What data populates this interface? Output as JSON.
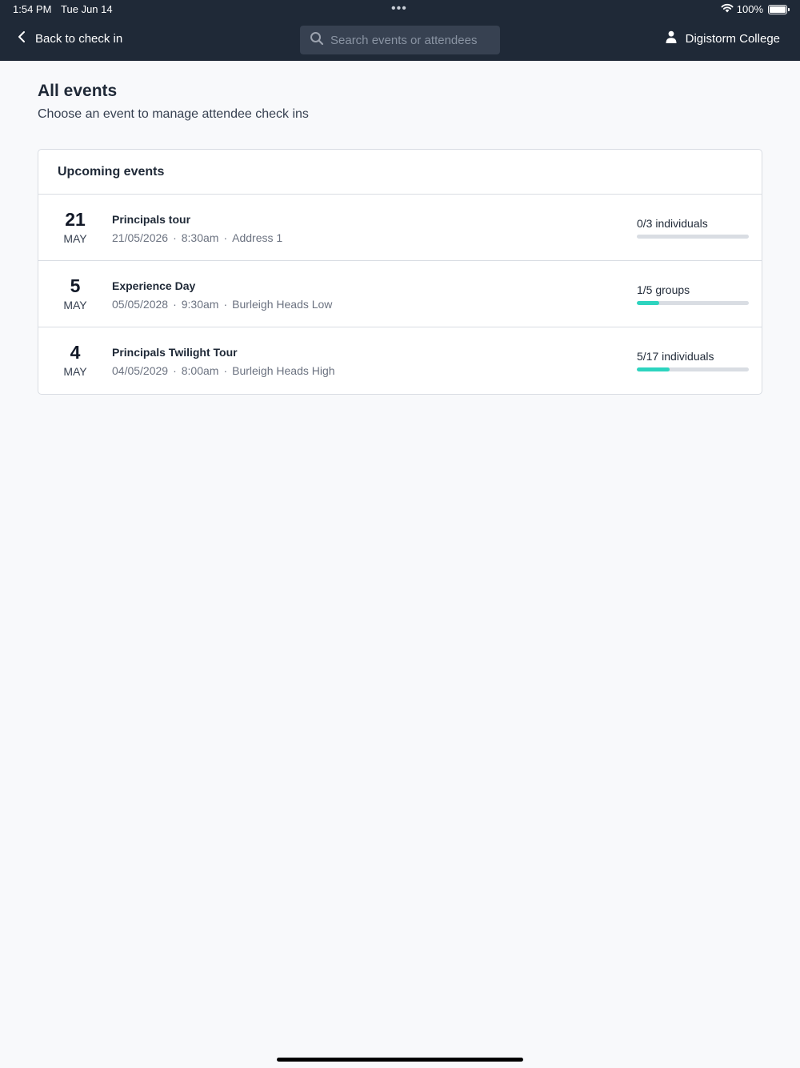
{
  "status_bar": {
    "time": "1:54 PM",
    "date": "Tue Jun 14",
    "battery": "100%",
    "battery_level": 1.0
  },
  "header": {
    "back_label": "Back to check in",
    "search_placeholder": "Search events or attendees",
    "account_name": "Digistorm College"
  },
  "page": {
    "title": "All events",
    "subtitle": "Choose an event to manage attendee check ins"
  },
  "upcoming": {
    "heading": "Upcoming events",
    "events": [
      {
        "day": "21",
        "month": "MAY",
        "name": "Principals tour",
        "date": "21/05/2026",
        "time": "8:30am",
        "location": "Address 1",
        "progress_label": "0/3 individuals",
        "progress": 0.0
      },
      {
        "day": "5",
        "month": "MAY",
        "name": "Experience Day",
        "date": "05/05/2028",
        "time": "9:30am",
        "location": "Burleigh Heads Low",
        "progress_label": "1/5 groups",
        "progress": 0.2
      },
      {
        "day": "4",
        "month": "MAY",
        "name": "Principals Twilight Tour",
        "date": "04/05/2029",
        "time": "8:00am",
        "location": "Burleigh Heads High",
        "progress_label": "5/17 individuals",
        "progress": 0.294
      }
    ]
  },
  "colors": {
    "topbar": "#1f2937",
    "accent": "#2dd4bf"
  }
}
